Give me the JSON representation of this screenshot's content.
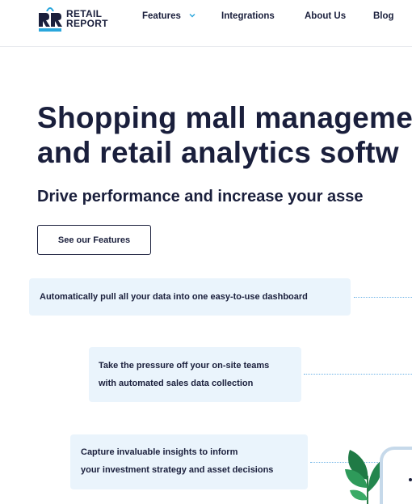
{
  "brand": {
    "line1": "RETAIL",
    "line2": "REPORT",
    "colors": {
      "navy": "#1a1f3c",
      "accent": "#2aa6dc",
      "callout_bg": "#eaf4fc"
    }
  },
  "nav": {
    "features": "Features",
    "integrations": "Integrations",
    "about": "About Us",
    "blog": "Blog"
  },
  "hero": {
    "title_line1": "Shopping mall manageme",
    "title_line2": "and retail analytics softw",
    "subtitle": "Drive performance and increase your asse",
    "cta": "See our Features"
  },
  "callouts": [
    {
      "line1": "Automatically pull all your data into one easy-to-use dashboard"
    },
    {
      "line1": "Take the pressure off your on-site teams",
      "line2": "with automated sales data collection"
    },
    {
      "line1": "Capture invaluable insights to inform",
      "line2": "your investment strategy and asset decisions"
    }
  ],
  "icons": {
    "logo": "retail-report-logo-icon",
    "chevron": "chevron-down-icon",
    "plant": "plant-icon"
  }
}
